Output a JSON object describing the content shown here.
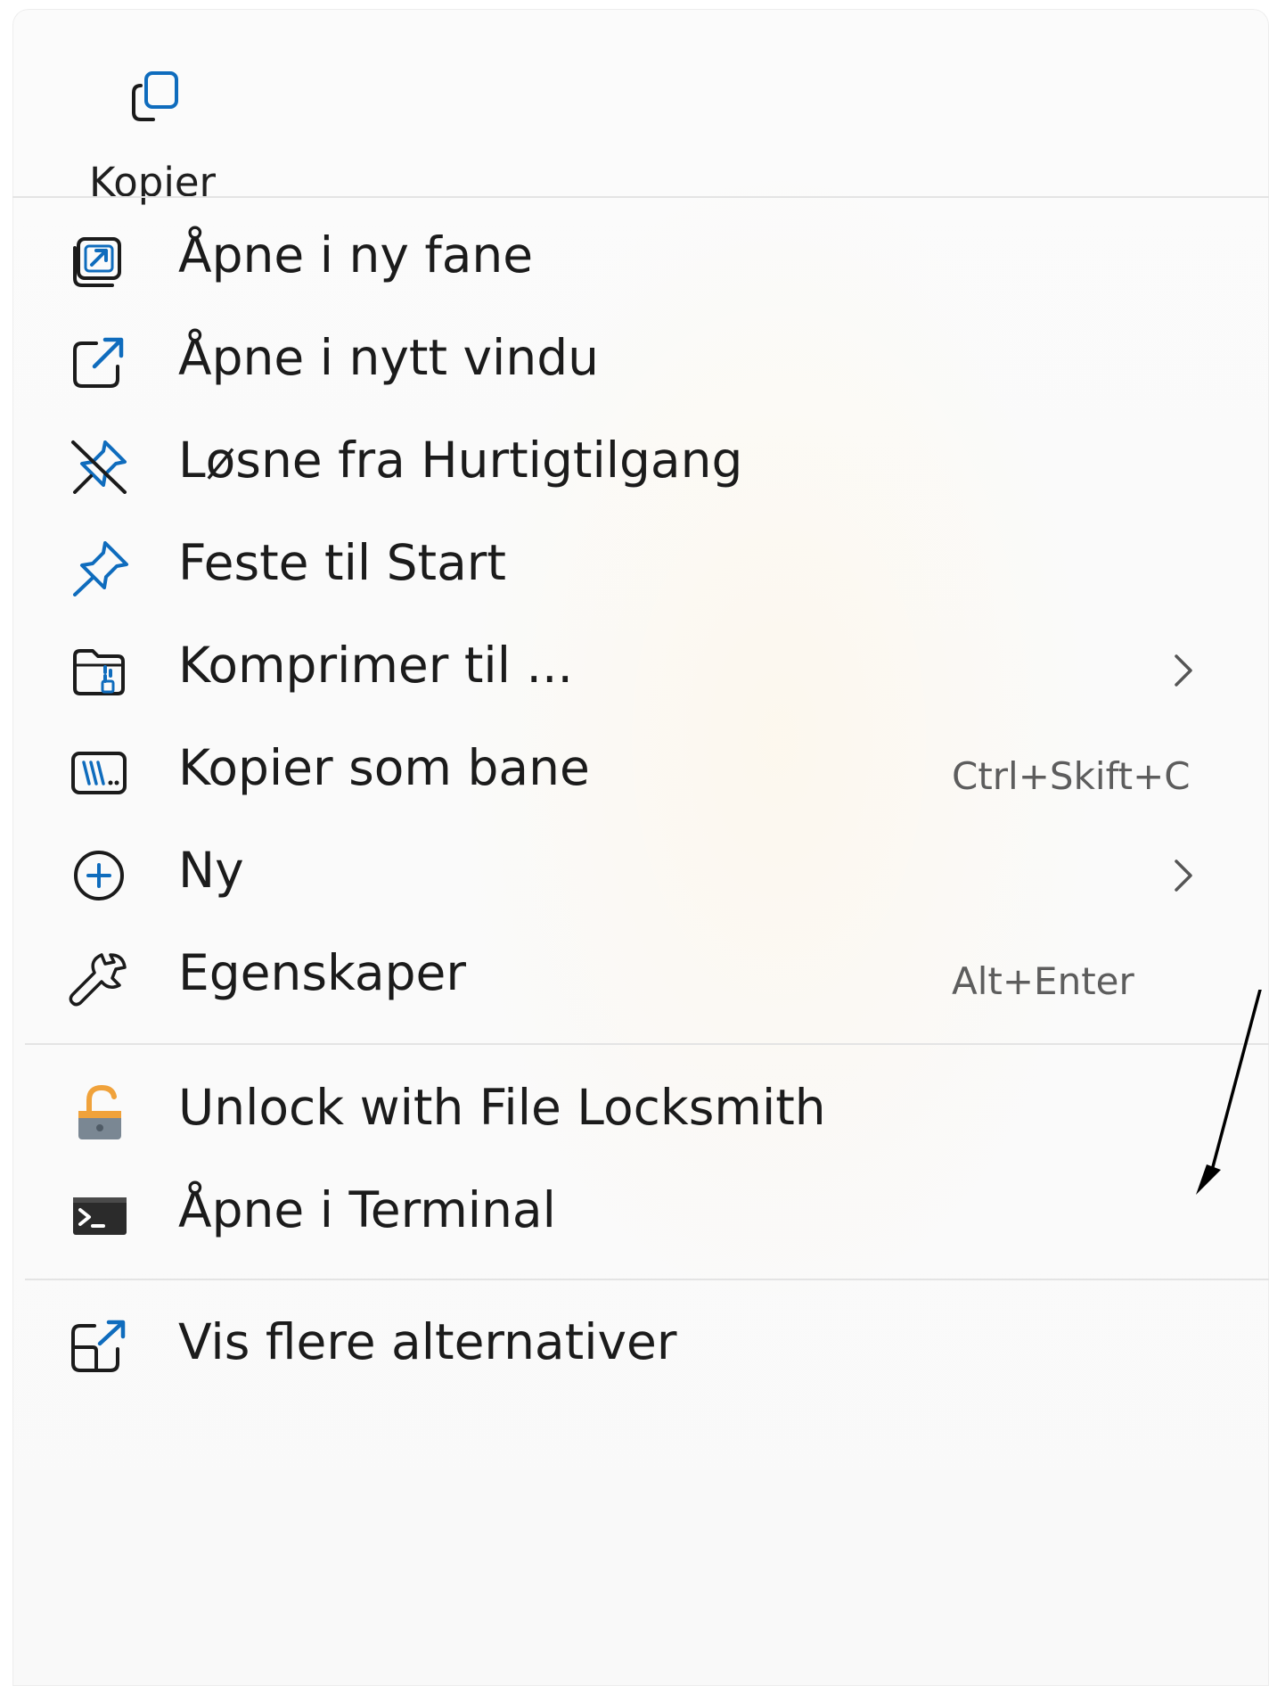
{
  "top_actions": {
    "copy": {
      "label": "Kopier",
      "icon": "copy-icon"
    }
  },
  "items": [
    {
      "label": "Åpne i ny fane",
      "icon": "open-new-tab-icon"
    },
    {
      "label": "Åpne i nytt vindu",
      "icon": "open-new-window-icon"
    },
    {
      "label": "Løsne fra Hurtigtilgang",
      "icon": "unpin-icon"
    },
    {
      "label": "Feste til Start",
      "icon": "pin-icon"
    },
    {
      "label": "Komprimer til ...",
      "icon": "zip-folder-icon",
      "submenu": true
    },
    {
      "label": "Kopier som bane",
      "icon": "copy-path-icon",
      "shortcut": "Ctrl+Skift+C"
    },
    {
      "label": "Ny",
      "icon": "add-circle-icon",
      "submenu": true
    },
    {
      "label": "Egenskaper",
      "icon": "wrench-icon",
      "shortcut": "Alt+Enter"
    },
    {
      "label": "Unlock with File Locksmith",
      "icon": "padlock-icon"
    },
    {
      "label": "Åpne i Terminal",
      "icon": "terminal-icon"
    },
    {
      "label": "Vis flere alternativer",
      "icon": "show-more-options-icon"
    }
  ],
  "colors": {
    "accent": "#0f6cbd",
    "text": "#1b1b1b",
    "shortcut_text": "#5d5d5d",
    "separator": "#e4e4e4",
    "lock_orange": "#f0a23b"
  }
}
